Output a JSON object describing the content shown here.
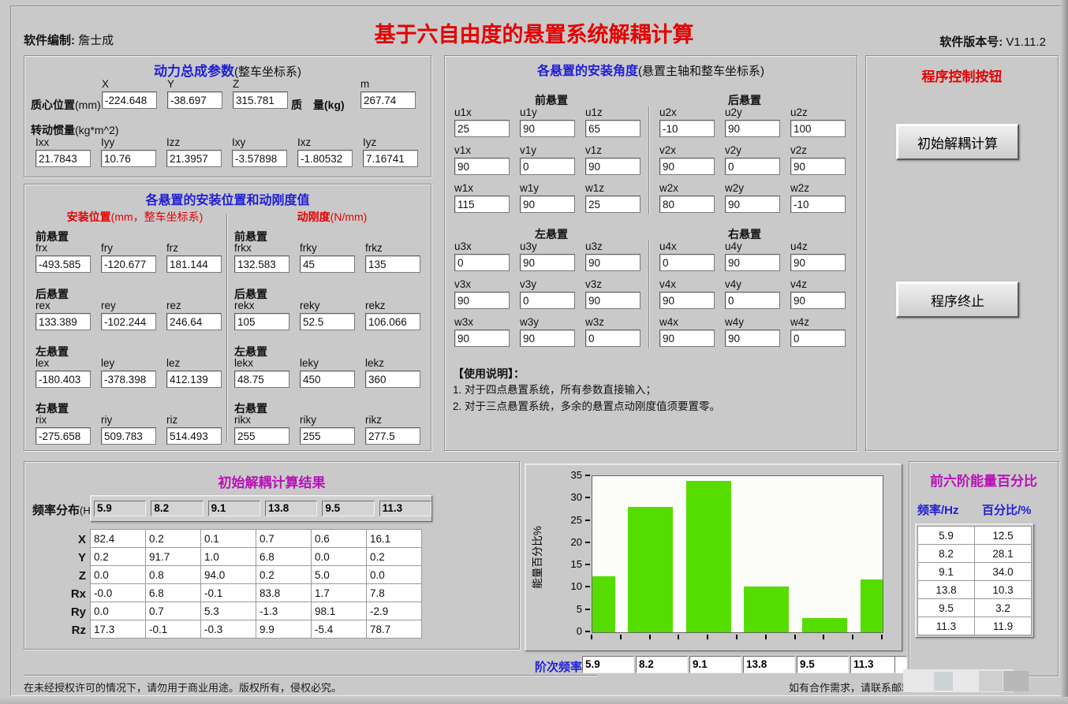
{
  "header": {
    "author_label": "软件编制:",
    "author": "詹士成",
    "title": "基于六自由度的悬置系统解耦计算",
    "version_label": "软件版本号:",
    "version": "V1.11.2"
  },
  "colors": {
    "title_red": "#e60000",
    "section_blue": "#1f1fd6",
    "section_magenta": "#b911b9",
    "bar_green": "#55dd00",
    "background_gray": "#c9c9c9"
  },
  "powertrain": {
    "title": "动力总成参数",
    "title_suffix": "(整车坐标系)",
    "centroid_label": "质心位置",
    "centroid_label_suffix": "(mm)",
    "centroid": [
      {
        "l": "X",
        "v": "-224.648"
      },
      {
        "l": "Y",
        "v": "-38.697"
      },
      {
        "l": "Z",
        "v": "315.781"
      }
    ],
    "mass_label": "质　量(kg)",
    "mass": [
      {
        "l": "m",
        "v": "267.74"
      }
    ],
    "inertia_label": "转动惯量",
    "inertia_label_suffix": "(kg*m^2)",
    "inertia": [
      {
        "l": "Ixx",
        "v": "21.7843"
      },
      {
        "l": "Iyy",
        "v": "10.76"
      },
      {
        "l": "Izz",
        "v": "21.3957"
      },
      {
        "l": "Ixy",
        "v": "-3.57898"
      },
      {
        "l": "Ixz",
        "v": "-1.80532"
      },
      {
        "l": "Iyz",
        "v": "7.16741"
      }
    ]
  },
  "mounts": {
    "title": "各悬置的安装位置和动刚度值",
    "pos_header": "安装位置",
    "pos_header_suffix": "(mm，整车坐标系)",
    "stiff_header": "动刚度",
    "stiff_header_suffix": "(N/mm)",
    "groups": [
      {
        "name": "前悬置",
        "pos": [
          {
            "l": "frx",
            "v": "-493.585"
          },
          {
            "l": "fry",
            "v": "-120.677"
          },
          {
            "l": "frz",
            "v": "181.144"
          }
        ],
        "stiff": [
          {
            "l": "frkx",
            "v": "132.583"
          },
          {
            "l": "frky",
            "v": "45"
          },
          {
            "l": "frkz",
            "v": "135"
          }
        ]
      },
      {
        "name": "后悬置",
        "pos": [
          {
            "l": "rex",
            "v": "133.389"
          },
          {
            "l": "rey",
            "v": "-102.244"
          },
          {
            "l": "rez",
            "v": "246.64"
          }
        ],
        "stiff": [
          {
            "l": "rekx",
            "v": "105"
          },
          {
            "l": "reky",
            "v": "52.5"
          },
          {
            "l": "rekz",
            "v": "106.066"
          }
        ]
      },
      {
        "name": "左悬置",
        "pos": [
          {
            "l": "lex",
            "v": "-180.403"
          },
          {
            "l": "ley",
            "v": "-378.398"
          },
          {
            "l": "lez",
            "v": "412.139"
          }
        ],
        "stiff": [
          {
            "l": "lekx",
            "v": "48.75"
          },
          {
            "l": "leky",
            "v": "450"
          },
          {
            "l": "lekz",
            "v": "360"
          }
        ]
      },
      {
        "name": "右悬置",
        "pos": [
          {
            "l": "rix",
            "v": "-275.658"
          },
          {
            "l": "riy",
            "v": "509.783"
          },
          {
            "l": "riz",
            "v": "514.493"
          }
        ],
        "stiff": [
          {
            "l": "rikx",
            "v": "255"
          },
          {
            "l": "riky",
            "v": "255"
          },
          {
            "l": "rikz",
            "v": "277.5"
          }
        ]
      }
    ]
  },
  "angles": {
    "title": "各悬置的安装角度",
    "title_suffix": "(悬置主轴和整车坐标系)",
    "groups": [
      {
        "name": "前悬置",
        "fields": [
          {
            "l": "u1x",
            "v": "25"
          },
          {
            "l": "u1y",
            "v": "90"
          },
          {
            "l": "u1z",
            "v": "65"
          },
          {
            "l": "v1x",
            "v": "90"
          },
          {
            "l": "v1y",
            "v": "0"
          },
          {
            "l": "v1z",
            "v": "90"
          },
          {
            "l": "w1x",
            "v": "115"
          },
          {
            "l": "w1y",
            "v": "90"
          },
          {
            "l": "w1z",
            "v": "25"
          }
        ]
      },
      {
        "name": "后悬置",
        "fields": [
          {
            "l": "u2x",
            "v": "-10"
          },
          {
            "l": "u2y",
            "v": "90"
          },
          {
            "l": "u2z",
            "v": "100"
          },
          {
            "l": "v2x",
            "v": "90"
          },
          {
            "l": "v2y",
            "v": "0"
          },
          {
            "l": "v2z",
            "v": "90"
          },
          {
            "l": "w2x",
            "v": "80"
          },
          {
            "l": "w2y",
            "v": "90"
          },
          {
            "l": "w2z",
            "v": "-10"
          }
        ]
      },
      {
        "name": "左悬置",
        "fields": [
          {
            "l": "u3x",
            "v": "0"
          },
          {
            "l": "u3y",
            "v": "90"
          },
          {
            "l": "u3z",
            "v": "90"
          },
          {
            "l": "v3x",
            "v": "90"
          },
          {
            "l": "v3y",
            "v": "0"
          },
          {
            "l": "v3z",
            "v": "90"
          },
          {
            "l": "w3x",
            "v": "90"
          },
          {
            "l": "w3y",
            "v": "90"
          },
          {
            "l": "w3z",
            "v": "0"
          }
        ]
      },
      {
        "name": "右悬置",
        "fields": [
          {
            "l": "u4x",
            "v": "0"
          },
          {
            "l": "u4y",
            "v": "90"
          },
          {
            "l": "u4z",
            "v": "90"
          },
          {
            "l": "v4x",
            "v": "90"
          },
          {
            "l": "v4y",
            "v": "0"
          },
          {
            "l": "v4z",
            "v": "90"
          },
          {
            "l": "w4x",
            "v": "90"
          },
          {
            "l": "w4y",
            "v": "90"
          },
          {
            "l": "w4z",
            "v": "0"
          }
        ]
      }
    ],
    "notes_title": "【使用说明】：",
    "notes": [
      "1. 对于四点悬置系统，所有参数直接输入；",
      "2. 对于三点悬置系统，多余的悬置点动刚度值须要置零。"
    ]
  },
  "controls": {
    "title": "程序控制按钮",
    "calc_button": "初始解耦计算",
    "stop_button": "程序终止"
  },
  "results": {
    "title": "初始解耦计算结果",
    "freq_label": "频率分布",
    "freq_label_suffix": "(Hz)",
    "frequencies": [
      "5.9",
      "8.2",
      "9.1",
      "13.8",
      "9.5",
      "11.3"
    ],
    "row_labels": [
      "X",
      "Y",
      "Z",
      "Rx",
      "Ry",
      "Rz"
    ],
    "matrix": [
      [
        "82.4",
        "0.2",
        "0.1",
        "0.7",
        "0.6",
        "16.1"
      ],
      [
        "0.2",
        "91.7",
        "1.0",
        "6.8",
        "0.0",
        "0.2"
      ],
      [
        "0.0",
        "0.8",
        "94.0",
        "0.2",
        "5.0",
        "0.0"
      ],
      [
        "-0.0",
        "6.8",
        "-0.1",
        "83.8",
        "1.7",
        "7.8"
      ],
      [
        "0.0",
        "0.7",
        "5.3",
        "-1.3",
        "98.1",
        "-2.9"
      ],
      [
        "17.3",
        "-0.1",
        "-0.3",
        "9.9",
        "-5.4",
        "78.7"
      ]
    ]
  },
  "chart_data": {
    "type": "bar",
    "categories": [
      "5.9",
      "8.2",
      "9.1",
      "13.8",
      "9.5",
      "11.3"
    ],
    "values": [
      12.5,
      28.1,
      34.0,
      10.3,
      3.2,
      11.9
    ],
    "title": "",
    "xlabel": "",
    "ylabel": "能量百分比%",
    "ylim": [
      0,
      35
    ],
    "ytick_step": 5,
    "grid": false,
    "legend": false,
    "bar_color": "#55dd00"
  },
  "order_freq": {
    "label": "阶次频率",
    "values": [
      "5.9",
      "8.2",
      "9.1",
      "13.8",
      "9.5",
      "11.3"
    ]
  },
  "energy": {
    "title": "前六阶能量百分比",
    "col_headers": [
      "频率/Hz",
      "百分比/%"
    ],
    "rows": [
      [
        "5.9",
        "12.5"
      ],
      [
        "8.2",
        "28.1"
      ],
      [
        "9.1",
        "34.0"
      ],
      [
        "13.8",
        "10.3"
      ],
      [
        "9.5",
        "3.2"
      ],
      [
        "11.3",
        "11.9"
      ]
    ]
  },
  "footer": {
    "left": "在未经授权许可的情况下，请勿用于商业用途。版权所有，侵权必究。",
    "right": "如有合作需求，请联系邮箱"
  }
}
